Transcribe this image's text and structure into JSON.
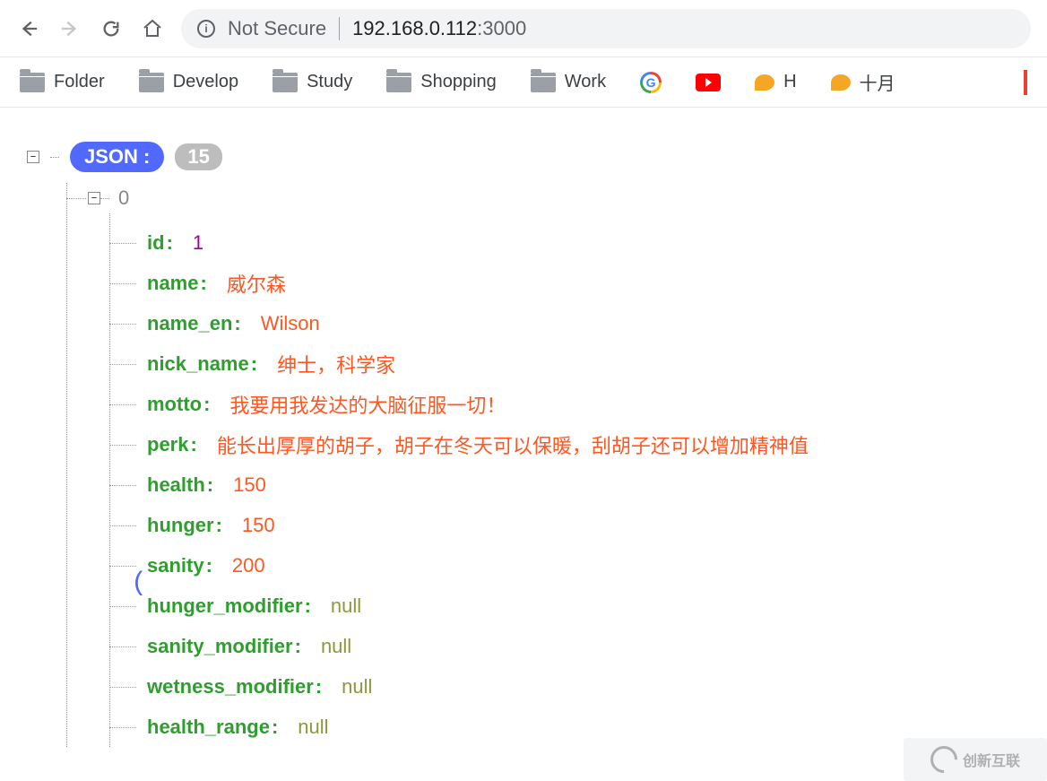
{
  "toolbar": {
    "not_secure": "Not Secure",
    "url_host": "192.168.0.112",
    "url_port": ":3000"
  },
  "bookmarks": {
    "folder": "Folder",
    "develop": "Develop",
    "study": "Study",
    "shopping": "Shopping",
    "work": "Work",
    "h": "H",
    "shiyue": "十月"
  },
  "json_view": {
    "root_label": "JSON :",
    "count": "15",
    "index0_label": "0",
    "properties": [
      {
        "key": "id",
        "value": "1",
        "type": "number"
      },
      {
        "key": "name",
        "value": "威尔森",
        "type": "string"
      },
      {
        "key": "name_en",
        "value": "Wilson",
        "type": "string"
      },
      {
        "key": "nick_name",
        "value": "绅士，科学家",
        "type": "string"
      },
      {
        "key": "motto",
        "value": "我要用我发达的大脑征服一切！",
        "type": "string"
      },
      {
        "key": "perk",
        "value": "能长出厚厚的胡子，胡子在冬天可以保暖，刮胡子还可以增加精神值",
        "type": "string"
      },
      {
        "key": "health",
        "value": "150",
        "type": "string"
      },
      {
        "key": "hunger",
        "value": "150",
        "type": "string"
      },
      {
        "key": "sanity",
        "value": "200",
        "type": "string"
      },
      {
        "key": "hunger_modifier",
        "value": "null",
        "type": "null"
      },
      {
        "key": "sanity_modifier",
        "value": "null",
        "type": "null"
      },
      {
        "key": "wetness_modifier",
        "value": "null",
        "type": "null"
      },
      {
        "key": "health_range",
        "value": "null",
        "type": "null"
      }
    ]
  },
  "watermark": "创新互联"
}
